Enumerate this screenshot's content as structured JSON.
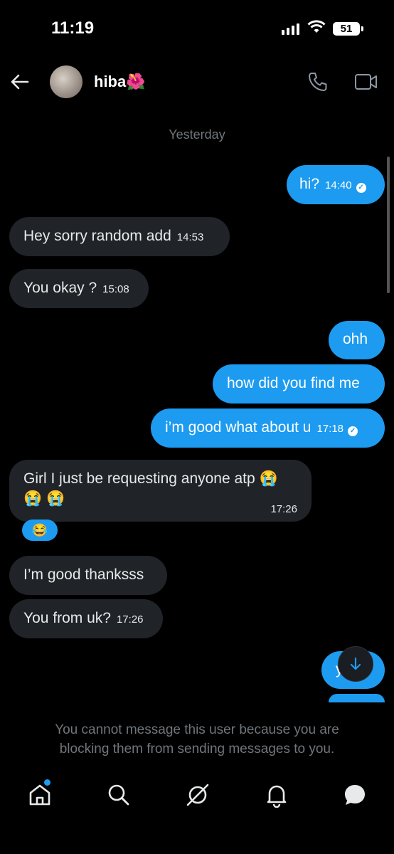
{
  "status": {
    "time": "11:19",
    "battery": "51"
  },
  "header": {
    "contact_name": "hiba🌺"
  },
  "chat": {
    "day_separator": "Yesterday",
    "messages": [
      {
        "text": "hi?",
        "time": "14:40"
      },
      {
        "text": "Hey sorry random add",
        "time": "14:53"
      },
      {
        "text": "You okay ?",
        "time": "15:08"
      },
      {
        "text": "ohh"
      },
      {
        "text": "how did you find me"
      },
      {
        "text": "i’m good what about u",
        "time": "17:18"
      },
      {
        "text_line1": "Girl I just be requesting anyone atp 😭",
        "text_line2": "😭 😭",
        "time": "17:26",
        "reaction": "😂"
      },
      {
        "text": "I’m good thanksss"
      },
      {
        "text": "You from uk?",
        "time": "17:26"
      },
      {
        "text": "y"
      }
    ]
  },
  "composer": {
    "blocked_notice": "You cannot message this user because you are blocking them from sending messages to you."
  },
  "colors": {
    "accent": "#1d9bf0",
    "received_bubble": "#202327",
    "background": "#000000"
  },
  "icons": {
    "back": "arrow-left-icon",
    "call": "phone-icon",
    "video": "video-camera-icon",
    "scroll_down": "arrow-down-icon"
  },
  "bottom_nav": [
    {
      "icon": "home-icon",
      "has_notification_dot": true
    },
    {
      "icon": "search-icon"
    },
    {
      "icon": "grok-icon"
    },
    {
      "icon": "bell-icon"
    },
    {
      "icon": "messages-icon"
    }
  ]
}
